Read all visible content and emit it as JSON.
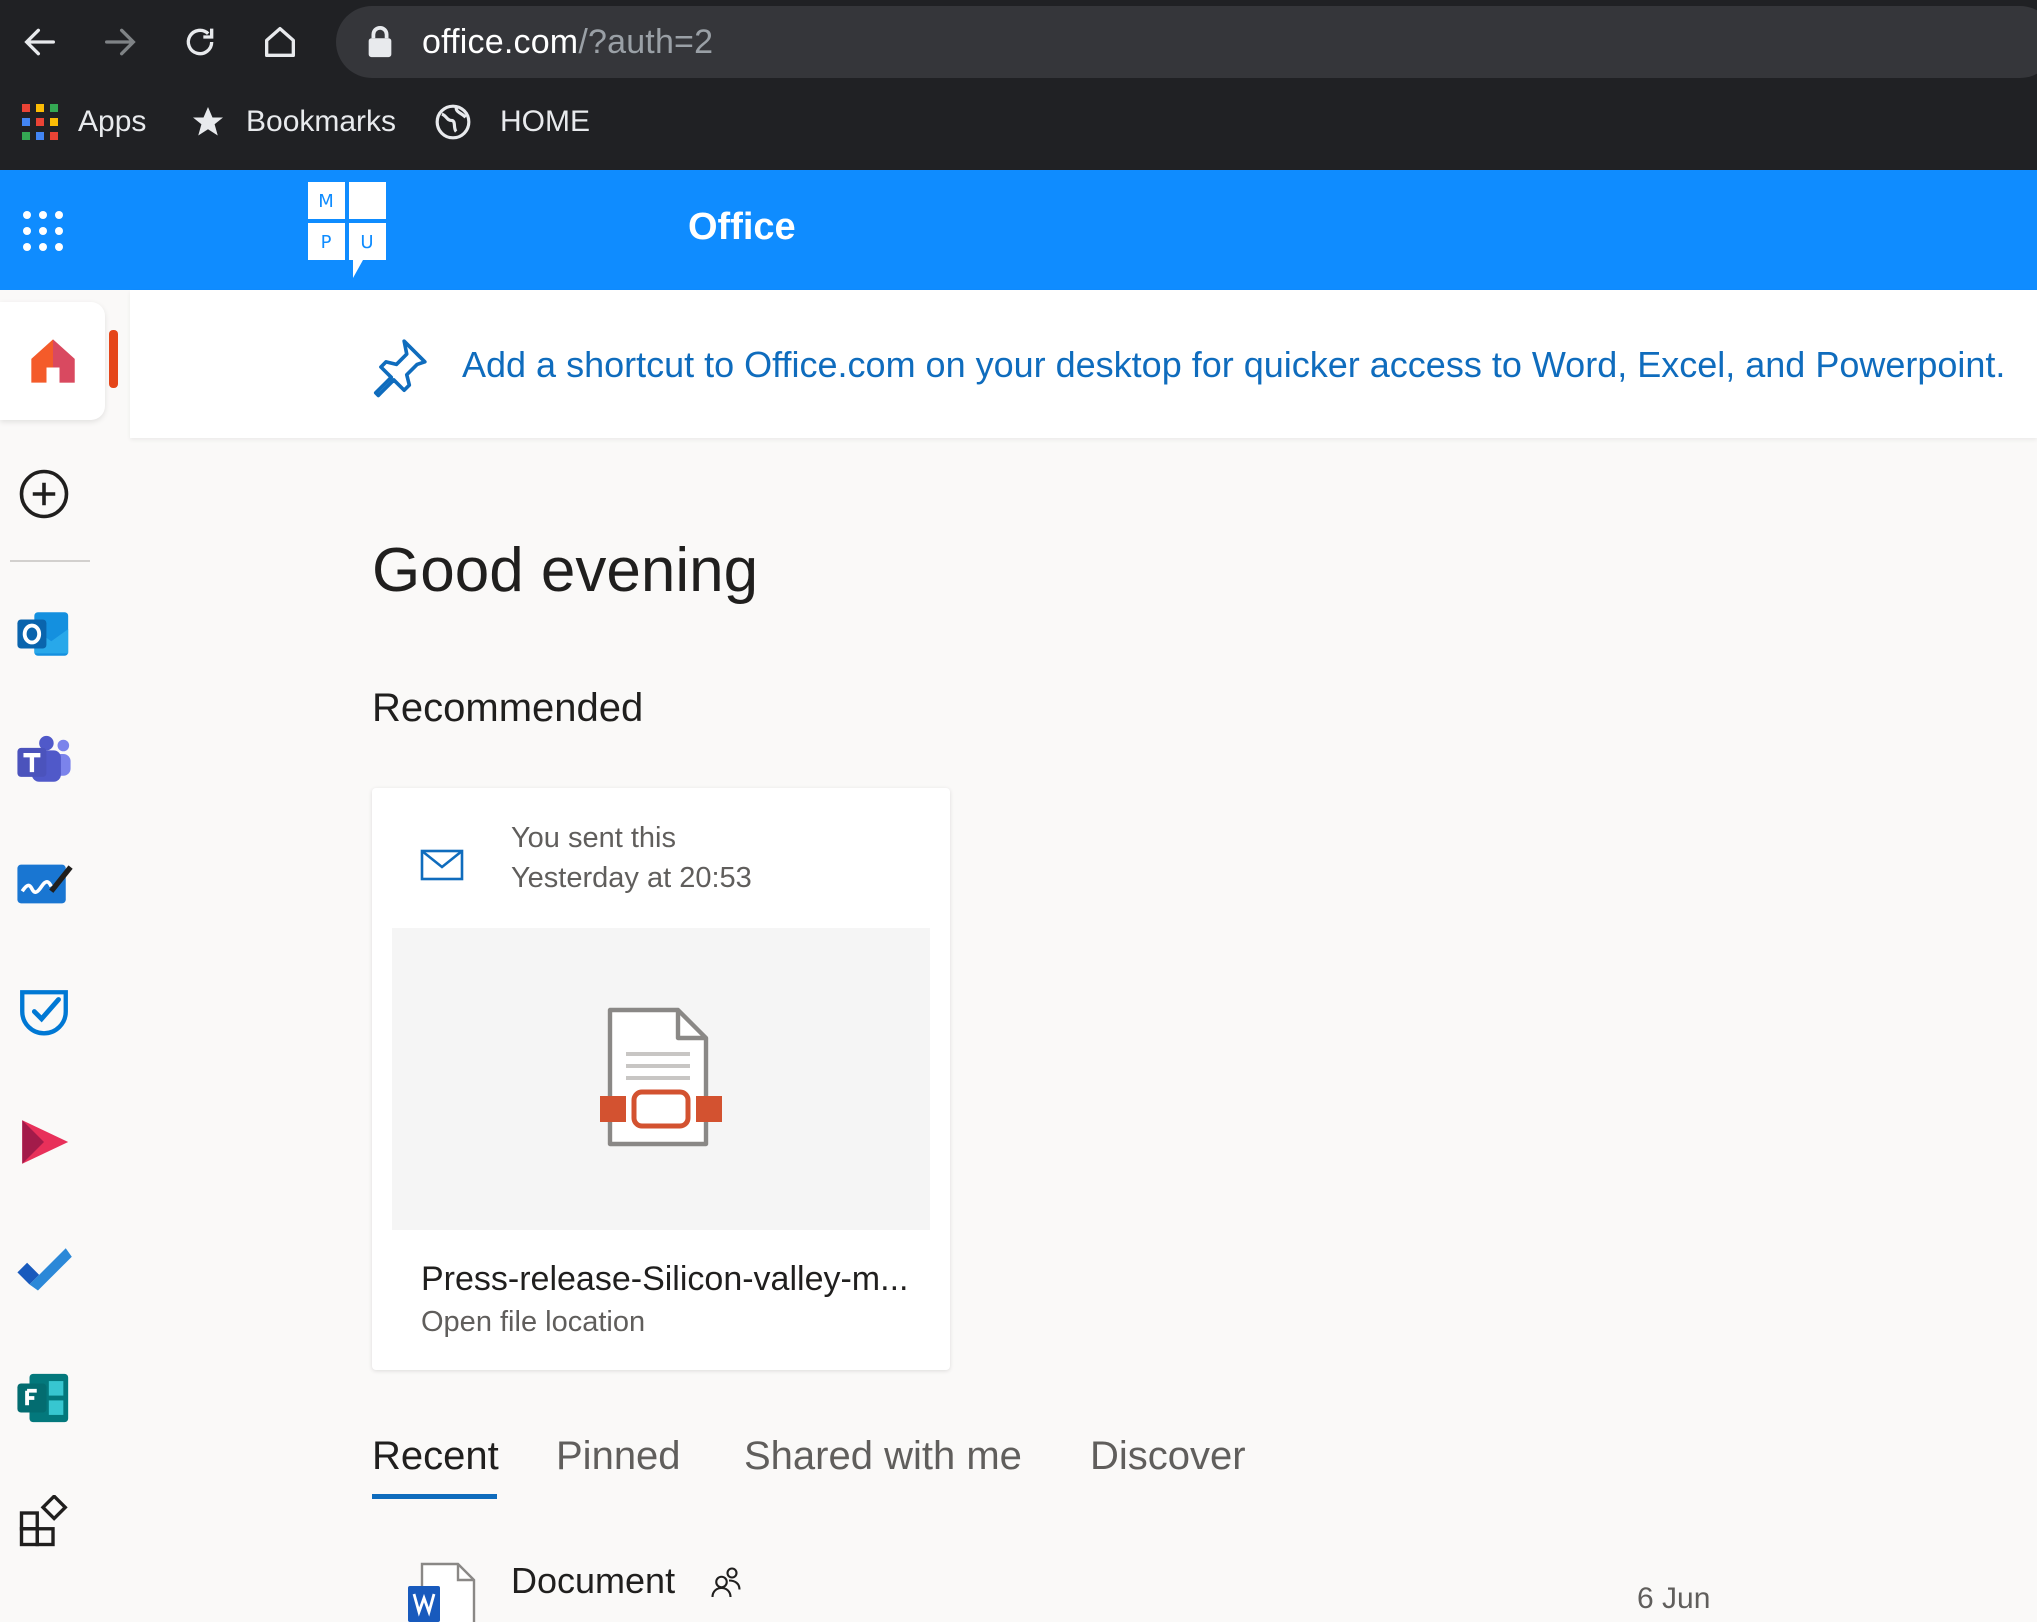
{
  "browser": {
    "url_host": "office.com",
    "url_rest": "/?auth=2",
    "bookmarks": [
      {
        "label": "Apps",
        "icon": "apps-grid-icon"
      },
      {
        "label": "Bookmarks",
        "icon": "star-icon"
      },
      {
        "label": "HOME",
        "icon": "globe-icon"
      }
    ]
  },
  "header": {
    "title": "Office",
    "logo_letters": [
      "M",
      "P",
      "U"
    ],
    "color": "#0f8cff"
  },
  "rail": {
    "items": [
      "home",
      "create",
      "outlook",
      "teams",
      "whiteboard",
      "bookings",
      "stream",
      "to-do",
      "forms",
      "all-apps"
    ]
  },
  "banner": {
    "text": "Add a shortcut to Office.com on your desktop for quicker access to Word, Excel, and Powerpoint."
  },
  "main": {
    "greeting": "Good evening",
    "recommended_title": "Recommended",
    "card": {
      "activity": "You sent this",
      "time": "Yesterday at 20:53",
      "file_name": "Press-release-Silicon-valley-m...",
      "action": "Open file location"
    },
    "tabs": [
      {
        "label": "Recent",
        "active": true
      },
      {
        "label": "Pinned",
        "active": false
      },
      {
        "label": "Shared with me",
        "active": false
      },
      {
        "label": "Discover",
        "active": false
      }
    ],
    "recent": [
      {
        "name": "Document",
        "date": "6 Jun"
      }
    ]
  }
}
